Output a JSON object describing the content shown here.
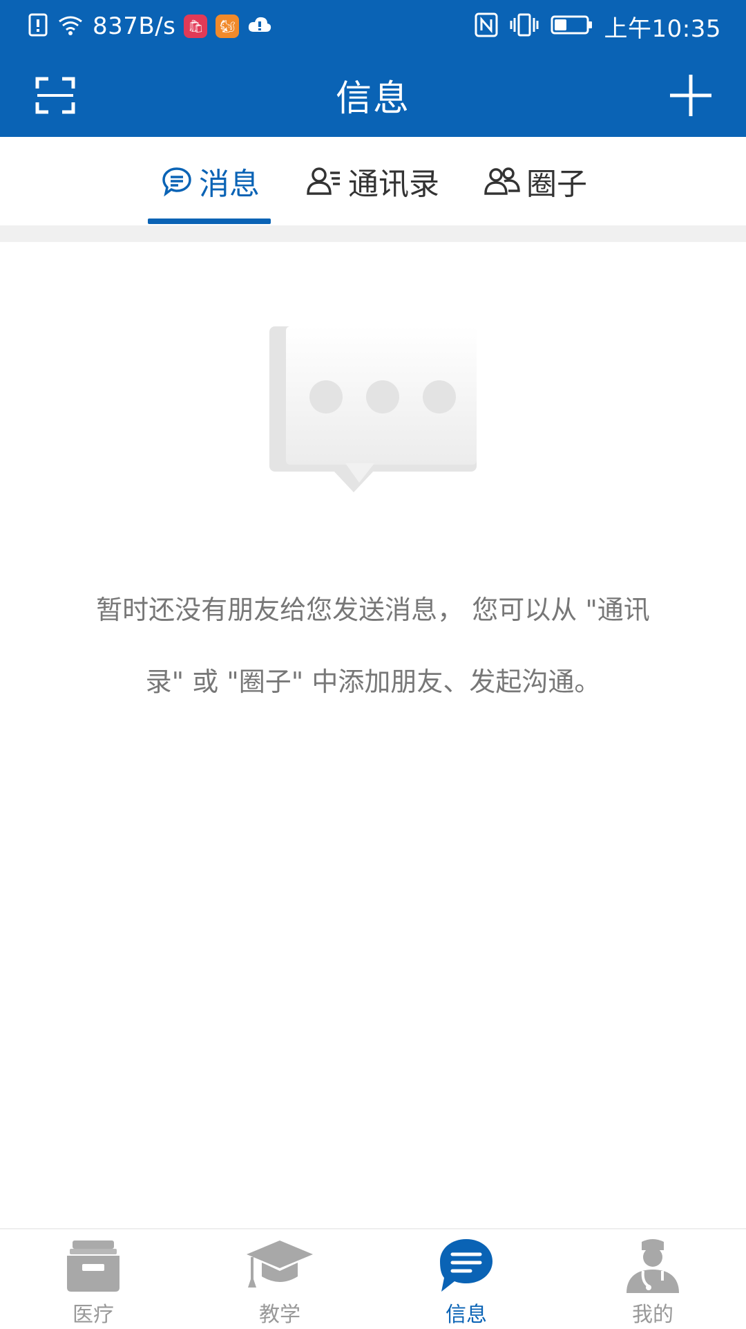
{
  "status_bar": {
    "net_speed": "837B/s",
    "time": "上午10:35",
    "icons": [
      "sim-alert-icon",
      "wifi-icon",
      "mall-app-icon",
      "uc-browser-icon",
      "cloud-icon",
      "nfc-icon",
      "vibrate-icon",
      "battery-icon"
    ],
    "battery_level": 0.35
  },
  "app_bar": {
    "title": "信息",
    "left_icon": "scan-icon",
    "right_icon": "plus-icon"
  },
  "tabs": [
    {
      "label": "消息",
      "icon": "chat-bubble-icon",
      "active": true
    },
    {
      "label": "通讯录",
      "icon": "contacts-icon",
      "active": false
    },
    {
      "label": "圈子",
      "icon": "group-icon",
      "active": false
    }
  ],
  "empty_state": {
    "icon": "message-bubble-icon",
    "line1": "暂时还没有朋友给您发送消息， 您可以从 \"通讯",
    "line2": "录\" 或 \"圈子\" 中添加朋友、发起沟通。"
  },
  "bottom_nav": [
    {
      "label": "医疗",
      "icon": "medical-box-icon",
      "active": false
    },
    {
      "label": "教学",
      "icon": "graduation-cap-icon",
      "active": false
    },
    {
      "label": "信息",
      "icon": "message-icon",
      "active": true
    },
    {
      "label": "我的",
      "icon": "doctor-icon",
      "active": false
    }
  ],
  "colors": {
    "primary": "#0a63b5",
    "inactive": "#999999",
    "text_secondary": "#777777"
  }
}
